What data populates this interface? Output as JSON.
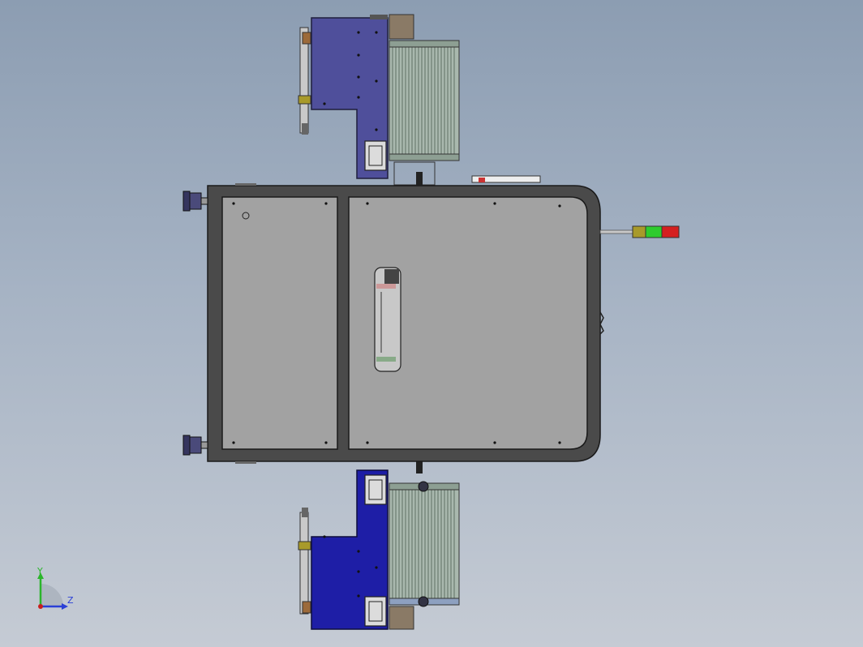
{
  "viewport": {
    "background_top": "#8c9db2",
    "background_bottom": "#c5cbd4"
  },
  "model": {
    "frame_color": "#4a4a4a",
    "panel_color": "#a2a2a2",
    "feeder_color_top": "#4f4f9b",
    "feeder_color_bottom": "#1e1ea6",
    "rack_color": "#b8c7b8",
    "signal_tower_colors": [
      "#a89a2a",
      "#2ecc2e",
      "#d42020"
    ]
  },
  "triad": {
    "y_label": "Y",
    "z_label": "Z",
    "y_color": "#2bb52b",
    "z_color": "#2a3fd6",
    "origin_color": "#c81e1e"
  }
}
